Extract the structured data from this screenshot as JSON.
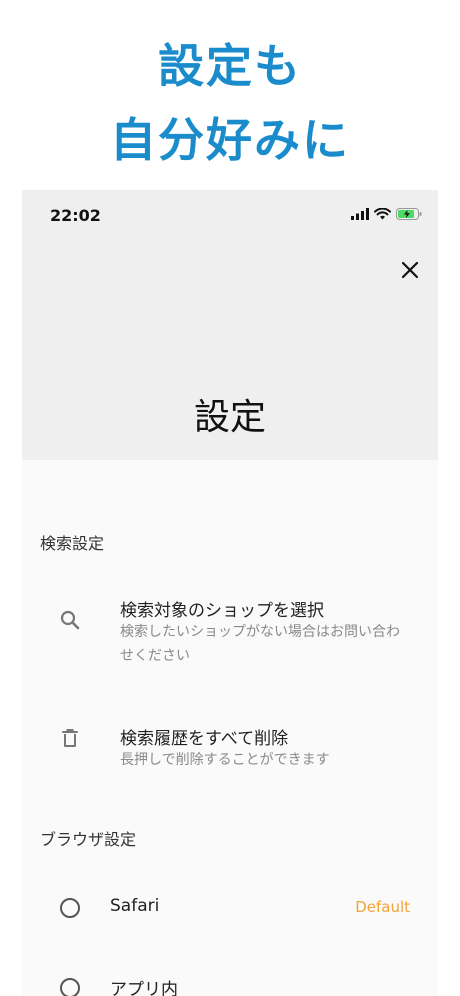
{
  "promo": {
    "line1": "設定も",
    "line2": "自分好みに"
  },
  "status_bar": {
    "time": "22:02"
  },
  "header": {
    "title": "設定"
  },
  "icons": {
    "close": "close-icon",
    "search": "search-icon",
    "trash": "trash-icon",
    "signal": "signal-icon",
    "wifi": "wifi-icon",
    "battery": "battery-charging-icon"
  },
  "sections": {
    "search": {
      "label": "検索設定",
      "items": [
        {
          "title": "検索対象のショップを選択",
          "subtitle": "検索したいショップがない場合はお問い合わせください"
        },
        {
          "title": "検索履歴をすべて削除",
          "subtitle": "長押しで削除することができます"
        }
      ]
    },
    "browser": {
      "label": "ブラウザ設定",
      "options": [
        {
          "label": "Safari",
          "badge": "Default"
        },
        {
          "label": "アプリ内"
        }
      ]
    }
  },
  "colors": {
    "accent_blue": "#1a8ccc",
    "default_badge": "#f2a33a",
    "header_bg": "#efefef",
    "battery_green": "#4cd964"
  }
}
